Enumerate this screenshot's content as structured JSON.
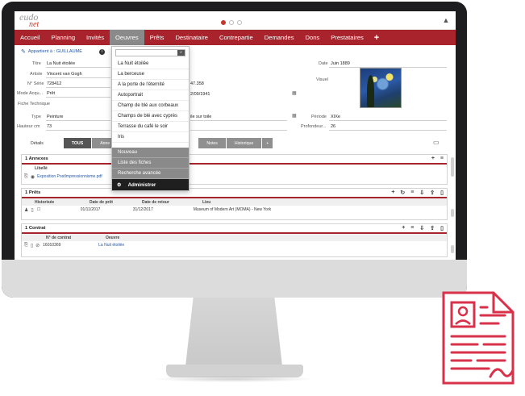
{
  "app": {
    "logo_top": "eudo",
    "logo_bottom": "net",
    "header_icon": "bell-icon"
  },
  "nav": {
    "items": [
      {
        "label": "Accueil"
      },
      {
        "label": "Planning"
      },
      {
        "label": "Invités"
      },
      {
        "label": "Oeuvres",
        "active": true
      },
      {
        "label": "Prêts"
      },
      {
        "label": "Destinataire"
      },
      {
        "label": "Contrepartie"
      },
      {
        "label": "Demandes"
      },
      {
        "label": "Dons"
      },
      {
        "label": "Prestataires"
      }
    ],
    "plus": "+"
  },
  "owner": {
    "text": "Appartient à : GUILLAUME",
    "info": "i"
  },
  "form": {
    "titre_label": "Titre",
    "titre_value": "La Nuit étoilée",
    "artiste_label": "Artiste",
    "artiste_value": "Vincent van Gogh",
    "serie_label": "N° Série",
    "serie_value": "728412",
    "mode_label": "Mode Acqu...",
    "mode_value": "Prêt",
    "fiche_label": "Fiche Technique",
    "type_label": "Type",
    "type_value": "Peinture",
    "hauteur_label": "Hauteur cm",
    "hauteur_value": "73",
    "mid1_value": "47.358",
    "mid2_value": "2/09/1941",
    "support_value": "ile sur toile",
    "date_label": "Date",
    "date_value": "Juin 1889",
    "visuel_label": "Visuel",
    "periode_label": "Période",
    "periode_value": "XIXe",
    "profondeur_label": "Profondeur...",
    "profondeur_value": "26"
  },
  "tabs": {
    "details": "Détails",
    "tous": "TOUS",
    "annexes": "Anne",
    "notes": "Notes",
    "historique": "Historique",
    "plus": "+"
  },
  "annexes": {
    "title": "1 Annexes",
    "col_libelle": "Libellé",
    "row_file": "Exposition PostImpressionnisme.pdf"
  },
  "prets": {
    "title": "1 Prêts",
    "columns": [
      "Historisée",
      "Date de prêt",
      "Date de retour",
      "Lieu"
    ],
    "row": [
      "",
      "01/11/2017",
      "31/12/2017",
      "Museum of Modern Art (MOMA) - New York"
    ]
  },
  "contrat": {
    "title": "1 Contrat",
    "columns": [
      "N° de contrat",
      "Oeuvre"
    ],
    "row": [
      "16010369",
      "La Nuit étoilée"
    ]
  },
  "dropdown": {
    "search_placeholder": "",
    "items": [
      "La Nuit étoilée",
      "La berceuse",
      "A la porte de l'éternité",
      "Autoportrait",
      "Champ de blé aux corbeaux",
      "Champs de blé avec cyprès",
      "Terrasse du café le soir",
      "Iris"
    ],
    "actions": [
      "Nouveau",
      "Liste des fiches",
      "Recherche avancée"
    ],
    "admin": "Administrer"
  },
  "colors": {
    "brand": "#a8232b",
    "nav_active": "#8a8a8a",
    "link": "#2457a6",
    "doc_icon": "#d9314a"
  }
}
